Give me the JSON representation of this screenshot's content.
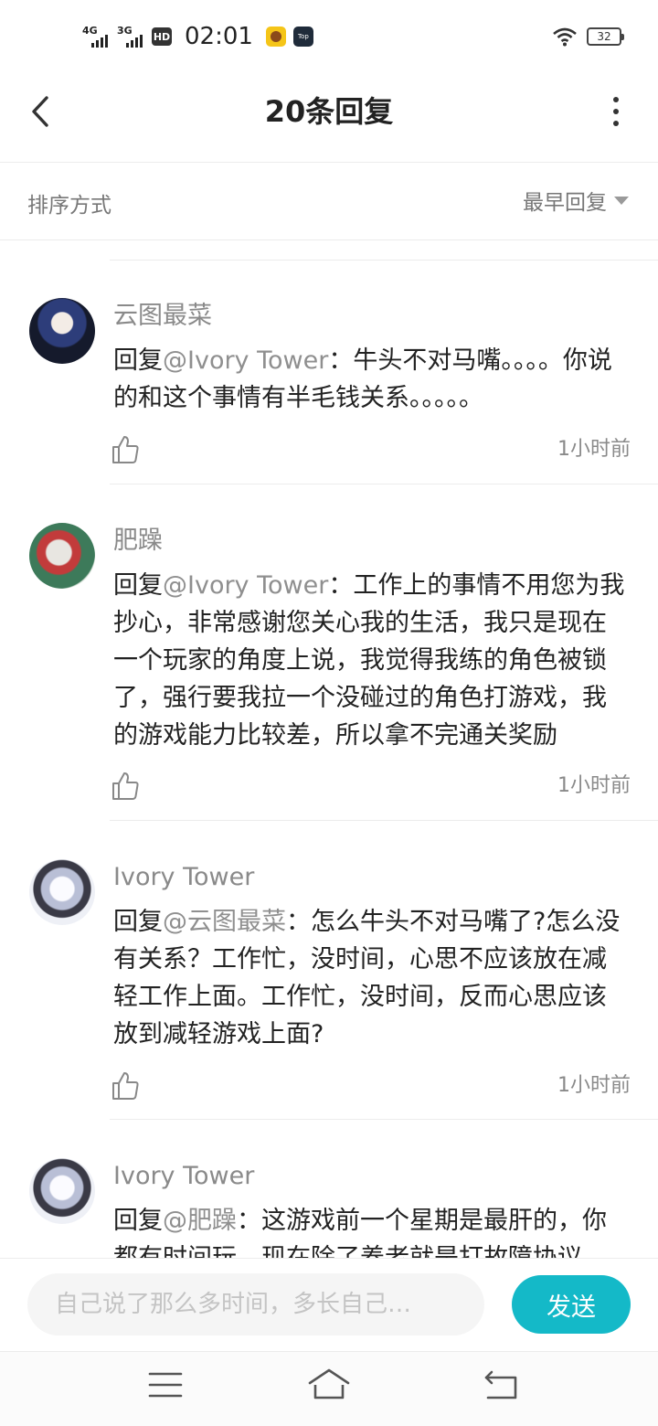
{
  "status_bar": {
    "signal1": "4G",
    "signal2": "3G",
    "hd": "HD",
    "time": "02:01",
    "app_icon2_text": "Top",
    "battery": "32"
  },
  "header": {
    "title": "20条回复",
    "back_icon": "back-arrow-icon",
    "more_icon": "more-vertical-icon"
  },
  "sort": {
    "label": "排序方式",
    "selected": "最早回复"
  },
  "comments": [
    {
      "name": "云图最菜",
      "prefix": "回复",
      "mention": "@Ivory Tower",
      "text": "：牛头不对马嘴。。。。你说的和这个事情有半毛钱关系。。。。。",
      "time": "1小时前"
    },
    {
      "name": "肥躁",
      "prefix": "回复",
      "mention": "@Ivory Tower",
      "text": "：工作上的事情不用您为我抄心，非常感谢您关心我的生活，我只是现在一个玩家的角度上说，我觉得我练的角色被锁了，强行要我拉一个没碰过的角色打游戏，我的游戏能力比较差，所以拿不完通关奖励",
      "time": "1小时前"
    },
    {
      "name": "Ivory Tower",
      "prefix": "回复",
      "mention": "@云图最菜",
      "text": "：怎么牛头不对马嘴了?怎么没有关系？工作忙，没时间，心思不应该放在减轻工作上面。工作忙，没时间，反而心思应该放到减轻游戏上面?",
      "time": "1小时前"
    },
    {
      "name": "Ivory Tower",
      "prefix": "回复",
      "mention": "@肥躁",
      "text": "：这游戏前一个星期是最肝的，你都有时间玩，现在除了养老就是打故障协议",
      "time": ""
    }
  ],
  "composer": {
    "placeholder": "自己说了那么多时间，多长自己…",
    "send_label": "发送"
  },
  "nav": {
    "menu_icon": "menu-icon",
    "home_icon": "home-icon",
    "back_icon": "return-icon"
  },
  "colors": {
    "accent": "#14b9c8",
    "mention": "#8f8f8f",
    "divider": "#ececec"
  }
}
